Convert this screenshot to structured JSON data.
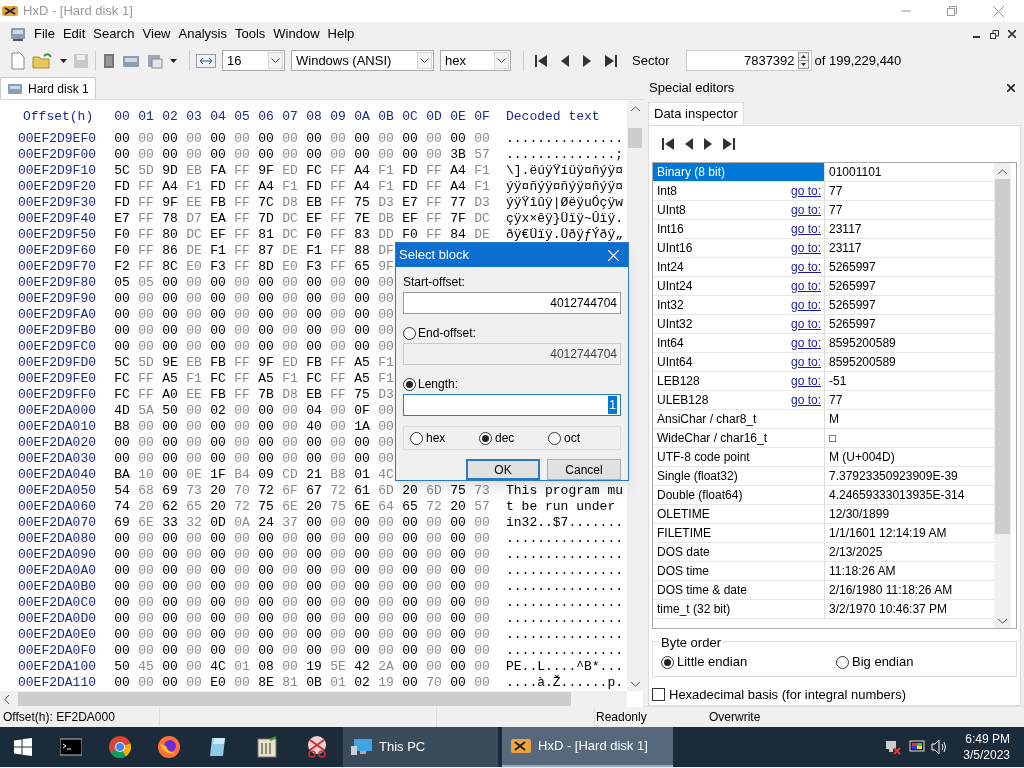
{
  "window": {
    "title": "HxD - [Hard disk 1]"
  },
  "menu": [
    "File",
    "Edit",
    "Search",
    "View",
    "Analysis",
    "Tools",
    "Window",
    "Help"
  ],
  "toolbar": {
    "bytes_per_row": "16",
    "encoding": "Windows (ANSI)",
    "offset_base": "hex",
    "sector_label": "Sector",
    "sector": "7837392",
    "sector_total": "of 199,229,440"
  },
  "tabs": [
    {
      "label": "Hard disk 1",
      "selected": true
    }
  ],
  "hex_view": {
    "header": {
      "offset": "Offset(h)",
      "columns": [
        "00",
        "01",
        "02",
        "03",
        "04",
        "05",
        "06",
        "07",
        "08",
        "09",
        "0A",
        "0B",
        "0C",
        "0D",
        "0E",
        "0F"
      ],
      "decoded": "Decoded text"
    },
    "rows": [
      {
        "offset": "00EF2D9EF0",
        "bytes": [
          "00",
          "00",
          "00",
          "00",
          "00",
          "00",
          "00",
          "00",
          "00",
          "00",
          "00",
          "00",
          "00",
          "00",
          "00",
          "00"
        ],
        "text": "..............."
      },
      {
        "offset": "00EF2D9F00",
        "bytes": [
          "00",
          "00",
          "00",
          "00",
          "00",
          "00",
          "00",
          "00",
          "00",
          "00",
          "00",
          "00",
          "00",
          "00",
          "3B",
          "57"
        ],
        "text": "..............;"
      },
      {
        "offset": "00EF2D9F10",
        "bytes": [
          "5C",
          "5D",
          "9D",
          "EB",
          "FA",
          "FF",
          "9F",
          "ED",
          "FC",
          "FF",
          "A4",
          "F1",
          "FD",
          "FF",
          "A4",
          "F1"
        ],
        "text": "\\].ëúÿŸíüÿ¤ñýÿ¤"
      },
      {
        "offset": "00EF2D9F20",
        "bytes": [
          "FD",
          "FF",
          "A4",
          "F1",
          "FD",
          "FF",
          "A4",
          "F1",
          "FD",
          "FF",
          "A4",
          "F1",
          "FD",
          "FF",
          "A4",
          "F1"
        ],
        "text": "ýÿ¤ñýÿ¤ñýÿ¤ñýÿ¤"
      },
      {
        "offset": "00EF2D9F30",
        "bytes": [
          "FD",
          "FF",
          "9F",
          "EE",
          "FB",
          "FF",
          "7C",
          "D8",
          "EB",
          "FF",
          "75",
          "D3",
          "E7",
          "FF",
          "77",
          "D3"
        ],
        "text": "ýÿŸîûÿ|ØëÿuÓçÿw"
      },
      {
        "offset": "00EF2D9F40",
        "bytes": [
          "E7",
          "FF",
          "78",
          "D7",
          "EA",
          "FF",
          "7D",
          "DC",
          "EF",
          "FF",
          "7E",
          "DB",
          "EF",
          "FF",
          "7F",
          "DC"
        ],
        "text": "çÿx×êÿ}Üïÿ~Ûïÿ."
      },
      {
        "offset": "00EF2D9F50",
        "bytes": [
          "F0",
          "FF",
          "80",
          "DC",
          "EF",
          "FF",
          "81",
          "DC",
          "F0",
          "FF",
          "83",
          "DD",
          "F0",
          "FF",
          "84",
          "DE"
        ],
        "text": "ðÿ€Üïÿ.ÜðÿƒÝðÿ„"
      },
      {
        "offset": "00EF2D9F60",
        "bytes": [
          "F0",
          "FF",
          "86",
          "DE",
          "F1",
          "FF",
          "87",
          "DE",
          "F1",
          "FF",
          "88",
          "DF"
        ]
      },
      {
        "offset": "00EF2D9F70",
        "bytes": [
          "F2",
          "FF",
          "8C",
          "E0",
          "F3",
          "FF",
          "8D",
          "E0",
          "F3",
          "FF",
          "65",
          "9F"
        ]
      },
      {
        "offset": "00EF2D9F80",
        "bytes": [
          "05",
          "05",
          "00",
          "00",
          "00",
          "00",
          "00",
          "00",
          "00",
          "00",
          "00",
          "00"
        ]
      },
      {
        "offset": "00EF2D9F90",
        "bytes": [
          "00",
          "00",
          "00",
          "00",
          "00",
          "00",
          "00",
          "00",
          "00",
          "00",
          "00",
          "00"
        ]
      },
      {
        "offset": "00EF2D9FA0",
        "bytes": [
          "00",
          "00",
          "00",
          "00",
          "00",
          "00",
          "00",
          "00",
          "00",
          "00",
          "00",
          "00"
        ]
      },
      {
        "offset": "00EF2D9FB0",
        "bytes": [
          "00",
          "00",
          "00",
          "00",
          "00",
          "00",
          "00",
          "00",
          "00",
          "00",
          "00",
          "00"
        ]
      },
      {
        "offset": "00EF2D9FC0",
        "bytes": [
          "00",
          "00",
          "00",
          "00",
          "00",
          "00",
          "00",
          "00",
          "00",
          "00",
          "00",
          "00"
        ]
      },
      {
        "offset": "00EF2D9FD0",
        "bytes": [
          "5C",
          "5D",
          "9E",
          "EB",
          "FB",
          "FF",
          "9F",
          "ED",
          "FB",
          "FF",
          "A5",
          "F1"
        ]
      },
      {
        "offset": "00EF2D9FE0",
        "bytes": [
          "FC",
          "FF",
          "A5",
          "F1",
          "FC",
          "FF",
          "A5",
          "F1",
          "FC",
          "FF",
          "A5",
          "F1"
        ]
      },
      {
        "offset": "00EF2D9FF0",
        "bytes": [
          "FC",
          "FF",
          "A0",
          "EE",
          "FB",
          "FF",
          "7B",
          "D8",
          "EB",
          "FF",
          "75",
          "D3"
        ]
      },
      {
        "offset": "00EF2DA000",
        "bytes": [
          "4D",
          "5A",
          "50",
          "00",
          "02",
          "00",
          "00",
          "00",
          "04",
          "00",
          "0F",
          "00"
        ]
      },
      {
        "offset": "00EF2DA010",
        "bytes": [
          "B8",
          "00",
          "00",
          "00",
          "00",
          "00",
          "00",
          "00",
          "40",
          "00",
          "1A",
          "00"
        ]
      },
      {
        "offset": "00EF2DA020",
        "bytes": [
          "00",
          "00",
          "00",
          "00",
          "00",
          "00",
          "00",
          "00",
          "00",
          "00",
          "00",
          "00"
        ]
      },
      {
        "offset": "00EF2DA030",
        "bytes": [
          "00",
          "00",
          "00",
          "00",
          "00",
          "00",
          "00",
          "00",
          "00",
          "00",
          "00",
          "00"
        ]
      },
      {
        "offset": "00EF2DA040",
        "bytes": [
          "BA",
          "10",
          "00",
          "0E",
          "1F",
          "B4",
          "09",
          "CD",
          "21",
          "B8",
          "01",
          "4C"
        ]
      },
      {
        "offset": "00EF2DA050",
        "bytes": [
          "54",
          "68",
          "69",
          "73",
          "20",
          "70",
          "72",
          "6F",
          "67",
          "72",
          "61",
          "6D",
          "20",
          "6D",
          "75",
          "73"
        ],
        "text": "This program mu"
      },
      {
        "offset": "00EF2DA060",
        "bytes": [
          "74",
          "20",
          "62",
          "65",
          "20",
          "72",
          "75",
          "6E",
          "20",
          "75",
          "6E",
          "64",
          "65",
          "72",
          "20",
          "57"
        ],
        "text": "t be run under"
      },
      {
        "offset": "00EF2DA070",
        "bytes": [
          "69",
          "6E",
          "33",
          "32",
          "0D",
          "0A",
          "24",
          "37",
          "00",
          "00",
          "00",
          "00",
          "00",
          "00",
          "00",
          "00"
        ],
        "text": "in32..$7......."
      },
      {
        "offset": "00EF2DA080",
        "bytes": [
          "00",
          "00",
          "00",
          "00",
          "00",
          "00",
          "00",
          "00",
          "00",
          "00",
          "00",
          "00",
          "00",
          "00",
          "00",
          "00"
        ],
        "text": "..............."
      },
      {
        "offset": "00EF2DA090",
        "bytes": [
          "00",
          "00",
          "00",
          "00",
          "00",
          "00",
          "00",
          "00",
          "00",
          "00",
          "00",
          "00",
          "00",
          "00",
          "00",
          "00"
        ],
        "text": "..............."
      },
      {
        "offset": "00EF2DA0A0",
        "bytes": [
          "00",
          "00",
          "00",
          "00",
          "00",
          "00",
          "00",
          "00",
          "00",
          "00",
          "00",
          "00",
          "00",
          "00",
          "00",
          "00"
        ],
        "text": "..............."
      },
      {
        "offset": "00EF2DA0B0",
        "bytes": [
          "00",
          "00",
          "00",
          "00",
          "00",
          "00",
          "00",
          "00",
          "00",
          "00",
          "00",
          "00",
          "00",
          "00",
          "00",
          "00"
        ],
        "text": "..............."
      },
      {
        "offset": "00EF2DA0C0",
        "bytes": [
          "00",
          "00",
          "00",
          "00",
          "00",
          "00",
          "00",
          "00",
          "00",
          "00",
          "00",
          "00",
          "00",
          "00",
          "00",
          "00"
        ],
        "text": "..............."
      },
      {
        "offset": "00EF2DA0D0",
        "bytes": [
          "00",
          "00",
          "00",
          "00",
          "00",
          "00",
          "00",
          "00",
          "00",
          "00",
          "00",
          "00",
          "00",
          "00",
          "00",
          "00"
        ],
        "text": "..............."
      },
      {
        "offset": "00EF2DA0E0",
        "bytes": [
          "00",
          "00",
          "00",
          "00",
          "00",
          "00",
          "00",
          "00",
          "00",
          "00",
          "00",
          "00",
          "00",
          "00",
          "00",
          "00"
        ],
        "text": "..............."
      },
      {
        "offset": "00EF2DA0F0",
        "bytes": [
          "00",
          "00",
          "00",
          "00",
          "00",
          "00",
          "00",
          "00",
          "00",
          "00",
          "00",
          "00",
          "00",
          "00",
          "00",
          "00"
        ],
        "text": "..............."
      },
      {
        "offset": "00EF2DA100",
        "bytes": [
          "50",
          "45",
          "00",
          "00",
          "4C",
          "01",
          "08",
          "00",
          "19",
          "5E",
          "42",
          "2A",
          "00",
          "00",
          "00",
          "00"
        ],
        "text": "PE..L....^B*..."
      },
      {
        "offset": "00EF2DA110",
        "bytes": [
          "00",
          "00",
          "00",
          "00",
          "E0",
          "00",
          "8E",
          "81",
          "0B",
          "01",
          "02",
          "19",
          "00",
          "70",
          "00",
          "00"
        ],
        "text": "....à.Ž......p."
      }
    ]
  },
  "special_editors": {
    "title": "Special editors",
    "tabs": [
      {
        "label": "Data inspector",
        "selected": true
      }
    ],
    "rows": [
      {
        "label": "Binary (8 bit)",
        "value": "01001101",
        "selected": true
      },
      {
        "label": "Int8",
        "link": "go to:",
        "value": "77",
        "selected": false
      },
      {
        "label": "UInt8",
        "link": "go to:",
        "value": "77",
        "selected": false
      },
      {
        "label": "Int16",
        "link": "go to:",
        "value": "23117",
        "selected": false
      },
      {
        "label": "UInt16",
        "link": "go to:",
        "value": "23117",
        "selected": false
      },
      {
        "label": "Int24",
        "link": "go to:",
        "value": "5265997",
        "selected": false
      },
      {
        "label": "UInt24",
        "link": "go to:",
        "value": "5265997",
        "selected": false
      },
      {
        "label": "Int32",
        "link": "go to:",
        "value": "5265997",
        "selected": false
      },
      {
        "label": "UInt32",
        "link": "go to:",
        "value": "5265997",
        "selected": false
      },
      {
        "label": "Int64",
        "link": "go to:",
        "value": "8595200589",
        "selected": false
      },
      {
        "label": "UInt64",
        "link": "go to:",
        "value": "8595200589",
        "selected": false
      },
      {
        "label": "LEB128",
        "link": "go to:",
        "value": "-51",
        "selected": false
      },
      {
        "label": "ULEB128",
        "link": "go to:",
        "value": "77",
        "selected": false
      },
      {
        "label": "AnsiChar / char8_t",
        "value": "M",
        "selected": false
      },
      {
        "label": "WideChar / char16_t",
        "value": "□",
        "selected": false
      },
      {
        "label": "UTF-8 code point",
        "value": "M (U+004D)",
        "selected": false
      },
      {
        "label": "Single (float32)",
        "value": "7.37923350923909E-39",
        "selected": false
      },
      {
        "label": "Double (float64)",
        "value": "4.24659333013935E-314",
        "selected": false
      },
      {
        "label": "OLETIME",
        "value": "12/30/1899",
        "selected": false
      },
      {
        "label": "FILETIME",
        "value": "1/1/1601 12:14:19 AM",
        "selected": false
      },
      {
        "label": "DOS date",
        "value": "2/13/2025",
        "selected": false
      },
      {
        "label": "DOS time",
        "value": "11:18:26 AM",
        "selected": false
      },
      {
        "label": "DOS time & date",
        "value": "2/16/1980 11:18:26 AM",
        "selected": false
      },
      {
        "label": "time_t (32 bit)",
        "value": "3/2/1970 10:46:37 PM",
        "selected": false
      }
    ],
    "byte_order": {
      "title": "Byte order",
      "options": [
        {
          "label": "Little endian",
          "selected": true
        },
        {
          "label": "Big endian",
          "selected": false
        }
      ]
    },
    "hex_basis": {
      "label": "Hexadecimal basis (for integral numbers)",
      "checked": false
    }
  },
  "dialog": {
    "title": "Select block",
    "start_offset": {
      "label": "Start-offset:",
      "value": "4012744704"
    },
    "end_offset": {
      "label": "End-offset:",
      "value": "4012744704",
      "selected": false
    },
    "length": {
      "label": "Length:",
      "value": "1",
      "selected": true
    },
    "bases": [
      {
        "label": "hex",
        "selected": false
      },
      {
        "label": "dec",
        "selected": true
      },
      {
        "label": "oct",
        "selected": false
      }
    ],
    "buttons": [
      "OK",
      "Cancel"
    ]
  },
  "status_bar": [
    "Offset(h): EF2DA000",
    "Readonly",
    "Overwrite"
  ],
  "taskbar": {
    "windows": [
      {
        "label": "This PC",
        "selected": false
      },
      {
        "label": "HxD - [Hard disk 1]",
        "selected": true
      }
    ],
    "time": "6:49 PM",
    "date": "3/5/2023"
  }
}
